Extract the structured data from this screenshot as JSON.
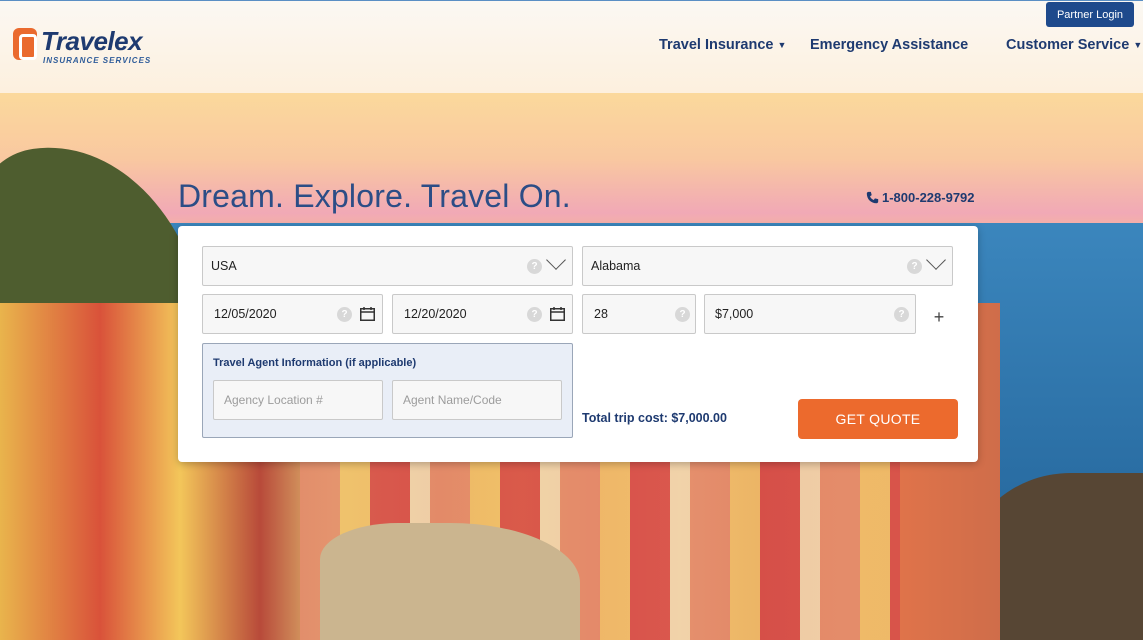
{
  "header": {
    "logo_name": "Travelex",
    "logo_sub": "INSURANCE SERVICES",
    "partner_login": "Partner Login",
    "nav": [
      {
        "label": "Travel Insurance",
        "has_dropdown": true
      },
      {
        "label": "Emergency Assistance",
        "has_dropdown": false
      },
      {
        "label": "Customer Service",
        "has_dropdown": true
      }
    ]
  },
  "hero": {
    "headline": "Dream. Explore. Travel On.",
    "phone": "1-800-228-9792"
  },
  "quote": {
    "country": "USA",
    "state": "Alabama",
    "depart_date": "12/05/2020",
    "return_date": "12/20/2020",
    "age": "28",
    "trip_cost": "$7,000",
    "help_symbol": "?",
    "add_symbol": "+",
    "agent": {
      "title": "Travel Agent Information (if applicable)",
      "location_placeholder": "Agency Location #",
      "name_placeholder": "Agent Name/Code"
    },
    "total_label": "Total trip cost: $7,000.00",
    "cta_label": "GET QUOTE"
  },
  "colors": {
    "brand_navy": "#1e3a70",
    "brand_orange": "#ec6a2d",
    "partner_blue": "#1e4a8c"
  }
}
